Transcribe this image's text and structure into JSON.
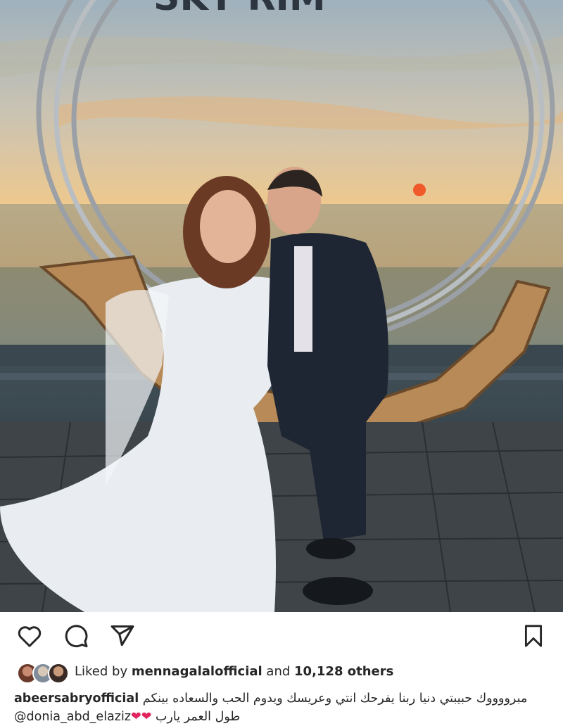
{
  "photo": {
    "alt_sign_text": "SKY RIM"
  },
  "actions": {
    "like_icon": "heart-outline-icon",
    "comment_icon": "comment-bubble-icon",
    "share_icon": "paper-plane-icon",
    "save_icon": "bookmark-icon"
  },
  "likes": {
    "prefix": "Liked by ",
    "user": "mennagalalofficial",
    "middle": " and ",
    "count": "10,128 others"
  },
  "caption": {
    "username": "abeersabryofficial",
    "text_line1": "مبرووووك حبيبتي دنيا ربنا يفرحك انتي وعريسك ويدوم الحب والسعاده بينكم",
    "mention": "@donia_abd_elaziz",
    "hearts": "❤❤",
    "text_line2": "طول العمر يارب"
  },
  "colors": {
    "heart": "#e0245e",
    "text": "#262626",
    "background": "#ffffff"
  }
}
